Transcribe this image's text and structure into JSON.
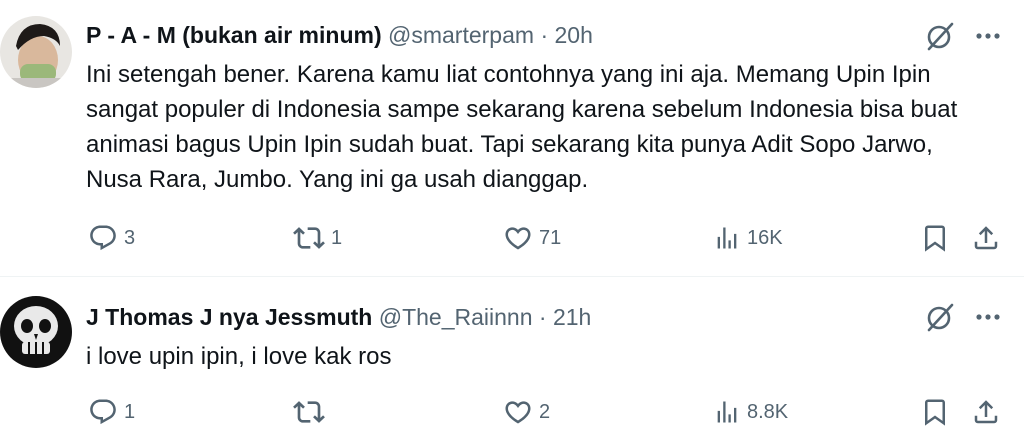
{
  "tweets": [
    {
      "display_name": "P - A - M (bukan air minum)",
      "handle": "@smarterpam",
      "separator": "·",
      "time": "20h",
      "text": "Ini setengah bener. Karena kamu liat contohnya yang ini aja. Memang Upin Ipin sangat populer di Indonesia sampe sekarang karena sebelum Indonesia bisa buat animasi bagus Upin Ipin sudah buat. Tapi sekarang kita punya Adit Sopo Jarwo, Nusa Rara, Jumbo. Yang ini ga usah dianggap.",
      "replies": "3",
      "retweets": "1",
      "likes": "71",
      "views": "16K"
    },
    {
      "display_name": "J Thomas J nya Jessmuth",
      "handle": "@The_Raiinnn",
      "separator": "·",
      "time": "21h",
      "text": "i love upin ipin, i love kak ros",
      "replies": "1",
      "retweets": "",
      "likes": "2",
      "views": "8.8K"
    }
  ],
  "colors": {
    "text": "#0f1419",
    "muted": "#536471",
    "divider": "#eff3f4"
  }
}
